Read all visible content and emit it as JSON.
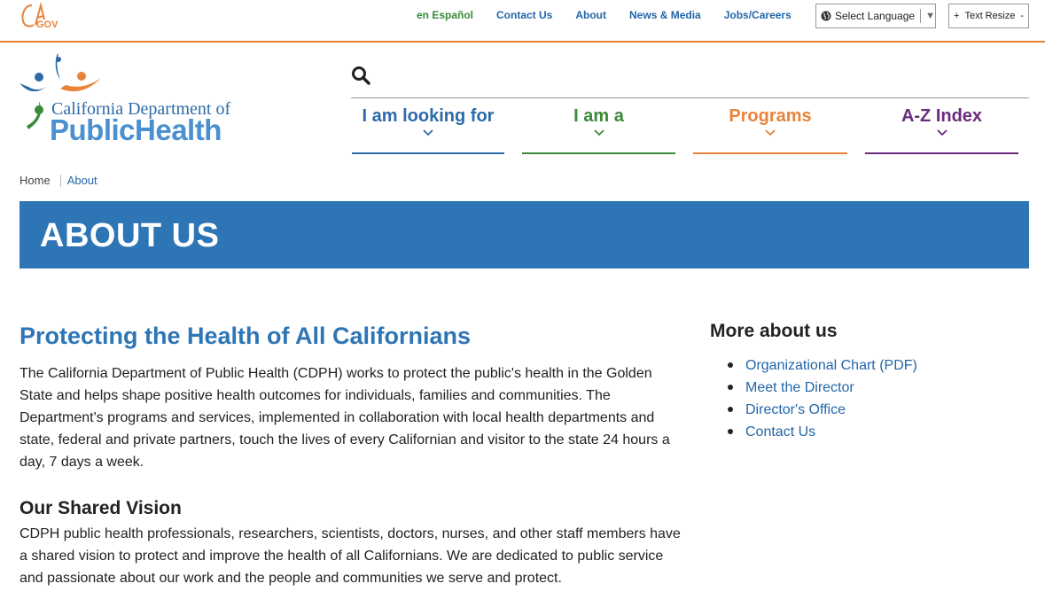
{
  "utility": {
    "cagov_logo": "CA.GOV",
    "links": [
      "en Español",
      "Contact Us",
      "About",
      "News & Media",
      "Jobs/Careers"
    ],
    "language_select": "Select Language",
    "text_resize": {
      "plus": "+",
      "label": "Text Resize",
      "minus": "-"
    }
  },
  "header": {
    "logo_line1": "California Department of",
    "logo_line2": "PublicHealth",
    "nav": [
      {
        "label": "I am looking for",
        "color": "#2d6aa8"
      },
      {
        "label": "I am a",
        "color": "#3a8a3a"
      },
      {
        "label": "Programs",
        "color": "#e8833a"
      },
      {
        "label": "A-Z Index",
        "color": "#6b2a7d"
      }
    ]
  },
  "breadcrumb": {
    "home": "Home",
    "current": "About"
  },
  "banner": {
    "title": "ABOUT US",
    "color": "#2e75b6"
  },
  "main": {
    "heading": "Protecting the Health of All Californians",
    "intro": "The California Department of Public Health (CDPH) works to protect the public's health in the Golden State and helps shape positive health outcomes for individuals, families and communities. The Department's programs and services, implemented in collaboration with local health departments and state, federal and private partners, touch the lives of every Californian and visitor to the state 24 hours a day, 7 days a week.",
    "vision_heading": "Our Shared Vision",
    "vision_text": "CDPH public health professionals, researchers, scientists, doctors, nurses, and other staff members have a shared vision to protect and improve the health of all Californians. We are dedicated to public service and passionate about our work and the people and communities we serve and protect."
  },
  "sidebar": {
    "heading": "More about us",
    "links": [
      "Organizational Chart (PDF)",
      "Meet the Director",
      "Director's Office",
      "Contact Us"
    ]
  }
}
